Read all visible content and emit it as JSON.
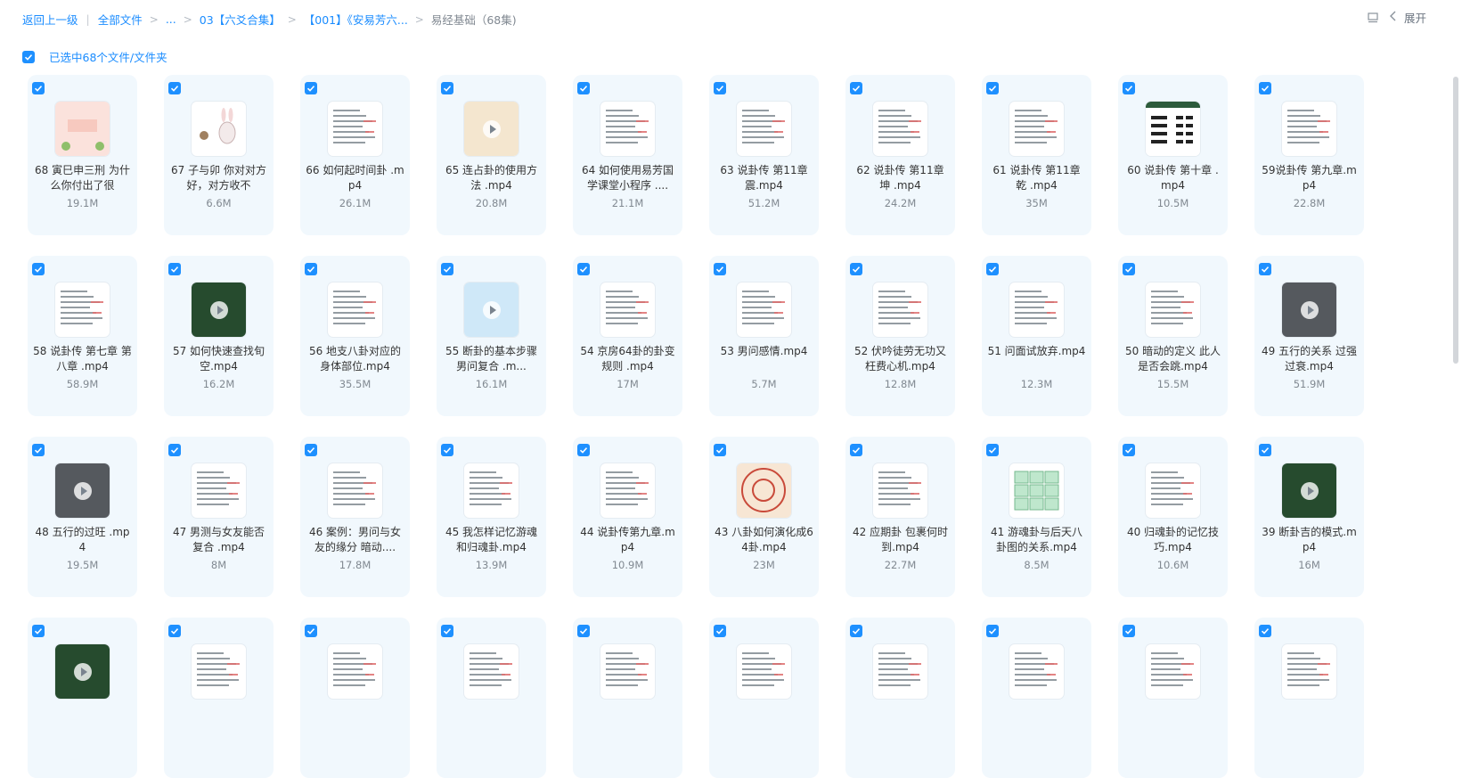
{
  "breadcrumb": {
    "back": "返回上一级",
    "all_files": "全部文件",
    "ellipsis": "...",
    "folder1": "03【六爻合集】",
    "folder2": "【001】《安易芳六...",
    "current": "易经基础（68集)"
  },
  "toolbar": {
    "expand_label": "展开"
  },
  "selection": {
    "label": "已选中68个文件/文件夹"
  },
  "colors": {
    "accent": "#1e90ff",
    "card_bg": "#f1f8fd"
  },
  "files": [
    {
      "name": "68 寅巳申三刑 为什么你付出了很",
      "size": "19.1M",
      "thumb": "pink"
    },
    {
      "name": "67 子与卯 你对对方好，对方收不",
      "size": "6.6M",
      "thumb": "rabbit"
    },
    {
      "name": "66 如何起时间卦 .mp4",
      "size": "26.1M",
      "thumb": "doc"
    },
    {
      "name": "65 连占卦的使用方法 .mp4",
      "size": "20.8M",
      "thumb": "beige"
    },
    {
      "name": "64 如何使用易芳国学课堂小程序 ....",
      "size": "21.1M",
      "thumb": "doc"
    },
    {
      "name": "63 说卦传 第11章 震.mp4",
      "size": "51.2M",
      "thumb": "doc"
    },
    {
      "name": "62 说卦传 第11章 坤 .mp4",
      "size": "24.2M",
      "thumb": "doc"
    },
    {
      "name": "61 说卦传 第11章 乾 .mp4",
      "size": "35M",
      "thumb": "doc"
    },
    {
      "name": "60 说卦传 第十章 .mp4",
      "size": "10.5M",
      "thumb": "trigram"
    },
    {
      "name": "59说卦传 第九章.mp4",
      "size": "22.8M",
      "thumb": "doc"
    },
    {
      "name": "58 说卦传 第七章 第八章 .mp4",
      "size": "58.9M",
      "thumb": "doc"
    },
    {
      "name": "57 如何快速查找旬空.mp4",
      "size": "16.2M",
      "thumb": "greenboard"
    },
    {
      "name": "56 地支八卦对应的身体部位.mp4",
      "size": "35.5M",
      "thumb": "doc"
    },
    {
      "name": "55 断卦的基本步骤 男问复合 .m...",
      "size": "16.1M",
      "thumb": "blue"
    },
    {
      "name": "54 京房64卦的卦变规则 .mp4",
      "size": "17M",
      "thumb": "doc"
    },
    {
      "name": "53 男问感情.mp4",
      "size": "5.7M",
      "thumb": "doc"
    },
    {
      "name": "52 伏吟徒劳无功又枉费心机.mp4",
      "size": "12.8M",
      "thumb": "doc"
    },
    {
      "name": "51 问面试放弃.mp4",
      "size": "12.3M",
      "thumb": "doc"
    },
    {
      "name": "50 暗动的定义 此人是否会跳.mp4",
      "size": "15.5M",
      "thumb": "doc"
    },
    {
      "name": "49 五行的关系 过强过衰.mp4",
      "size": "51.9M",
      "thumb": "slate"
    },
    {
      "name": "48 五行的过旺 .mp4",
      "size": "19.5M",
      "thumb": "slate"
    },
    {
      "name": "47 男测与女友能否复合 .mp4",
      "size": "8M",
      "thumb": "doc"
    },
    {
      "name": "46 案例：男问与女友的缘分 暗动....",
      "size": "17.8M",
      "thumb": "doc"
    },
    {
      "name": "45 我怎样记忆游魂和归魂卦.mp4",
      "size": "13.9M",
      "thumb": "doc"
    },
    {
      "name": "44 说卦传第九章.mp4",
      "size": "10.9M",
      "thumb": "doc"
    },
    {
      "name": "43 八卦如何演化成64卦.mp4",
      "size": "23M",
      "thumb": "circle"
    },
    {
      "name": "42 应期卦 包裹何时到.mp4",
      "size": "22.7M",
      "thumb": "doc"
    },
    {
      "name": "41 游魂卦与后天八卦图的关系.mp4",
      "size": "8.5M",
      "thumb": "greentable"
    },
    {
      "name": "40 归魂卦的记忆技巧.mp4",
      "size": "10.6M",
      "thumb": "doc"
    },
    {
      "name": "39 断卦吉的模式.mp4",
      "size": "16M",
      "thumb": "greenboard"
    },
    {
      "name": "",
      "size": "",
      "thumb": "greenboard"
    },
    {
      "name": "",
      "size": "",
      "thumb": "doc"
    },
    {
      "name": "",
      "size": "",
      "thumb": "doc"
    },
    {
      "name": "",
      "size": "",
      "thumb": "doc"
    },
    {
      "name": "",
      "size": "",
      "thumb": "doc"
    },
    {
      "name": "",
      "size": "",
      "thumb": "doc"
    },
    {
      "name": "",
      "size": "",
      "thumb": "doc"
    },
    {
      "name": "",
      "size": "",
      "thumb": "doc"
    },
    {
      "name": "",
      "size": "",
      "thumb": "doc"
    },
    {
      "name": "",
      "size": "",
      "thumb": "doc"
    }
  ]
}
